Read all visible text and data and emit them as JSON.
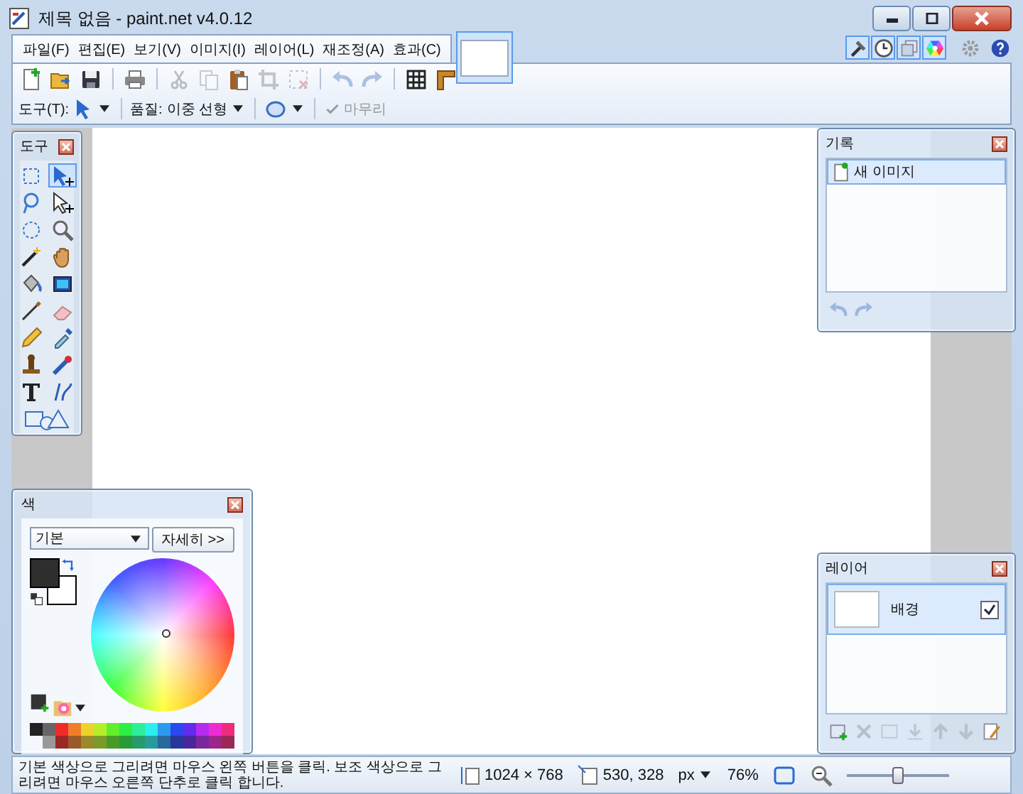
{
  "window": {
    "title": "제목 없음 - paint.net v4.0.12"
  },
  "menu": [
    "파일(F)",
    "편집(E)",
    "보기(V)",
    "이미지(I)",
    "레이어(L)",
    "재조정(A)",
    "효과(C)"
  ],
  "panel_toggles": [
    {
      "kind": "tools",
      "selected": true
    },
    {
      "kind": "history",
      "selected": true
    },
    {
      "kind": "layers",
      "selected": true
    },
    {
      "kind": "colors",
      "selected": true
    }
  ],
  "utility_buttons": [
    {
      "kind": "settings"
    },
    {
      "kind": "help"
    }
  ],
  "toolbar": [
    {
      "kind": "new",
      "disabled": false
    },
    {
      "kind": "open",
      "disabled": false
    },
    {
      "kind": "save",
      "disabled": false
    },
    {
      "kind": "print",
      "disabled": false
    },
    {
      "kind": "cut",
      "disabled": true
    },
    {
      "kind": "copy",
      "disabled": true
    },
    {
      "kind": "paste",
      "disabled": false
    },
    {
      "kind": "crop",
      "disabled": true
    },
    {
      "kind": "deselect",
      "disabled": true
    },
    {
      "kind": "undo",
      "disabled": true
    },
    {
      "kind": "redo",
      "disabled": true
    },
    {
      "kind": "grid",
      "disabled": false
    },
    {
      "kind": "ruler",
      "disabled": false
    }
  ],
  "tool_options": {
    "tool_label": "도구(T):",
    "quality_label": "품질:",
    "quality_value": "이중 선형",
    "finish": {
      "label": "마무리",
      "disabled": true
    }
  },
  "tools_window": {
    "title": "도구",
    "tools": [
      {
        "kind": "rectangle-select",
        "selected": false
      },
      {
        "kind": "move-selected",
        "selected": true
      },
      {
        "kind": "lasso-select",
        "selected": false
      },
      {
        "kind": "move-selection",
        "selected": false
      },
      {
        "kind": "ellipse-select",
        "selected": false
      },
      {
        "kind": "zoom",
        "selected": false
      },
      {
        "kind": "magic-wand",
        "selected": false
      },
      {
        "kind": "pan",
        "selected": false
      },
      {
        "kind": "paint-bucket",
        "selected": false
      },
      {
        "kind": "gradient",
        "selected": false
      },
      {
        "kind": "paintbrush",
        "selected": false
      },
      {
        "kind": "eraser",
        "selected": false
      },
      {
        "kind": "pencil",
        "selected": false
      },
      {
        "kind": "color-picker",
        "selected": false
      },
      {
        "kind": "clone-stamp",
        "selected": false
      },
      {
        "kind": "recolor",
        "selected": false
      },
      {
        "kind": "text",
        "selected": false
      },
      {
        "kind": "line",
        "selected": false
      },
      {
        "kind": "shapes",
        "selected": false
      }
    ]
  },
  "history_window": {
    "title": "기록",
    "items": [
      {
        "label": "새 이미지",
        "selected": true
      }
    ],
    "buttons": [
      {
        "kind": "undo",
        "disabled": true
      },
      {
        "kind": "redo",
        "disabled": true
      }
    ]
  },
  "colors_window": {
    "title": "색",
    "palette_menu": "기본",
    "more_button": "자세히 >>",
    "swatches": [
      {
        "kind": "primary",
        "color": "#2e2e2e"
      },
      {
        "kind": "secondary",
        "color": "#ffffff"
      }
    ]
  },
  "layers_window": {
    "title": "레이어",
    "layers": [
      {
        "name": "배경",
        "visible": true,
        "selected": true
      }
    ],
    "buttons": [
      {
        "kind": "add-layer",
        "disabled": false
      },
      {
        "kind": "delete-layer",
        "disabled": true
      },
      {
        "kind": "duplicate-layer",
        "disabled": true
      },
      {
        "kind": "merge-down",
        "disabled": true
      },
      {
        "kind": "move-up",
        "disabled": true
      },
      {
        "kind": "move-down",
        "disabled": true
      },
      {
        "kind": "properties",
        "disabled": false
      }
    ]
  },
  "status_bar": {
    "hint": "기본 색상으로 그리려면 마우스 왼쪽 버튼을 클릭. 보조 색상으로 그리려면 마우스 오른쪽 단추로 클릭 합니다.",
    "image_size": "1024 × 768",
    "cursor_position": "530, 328",
    "unit": "px",
    "zoom": "76%",
    "zoom_slider": {
      "level": 0.5
    }
  }
}
